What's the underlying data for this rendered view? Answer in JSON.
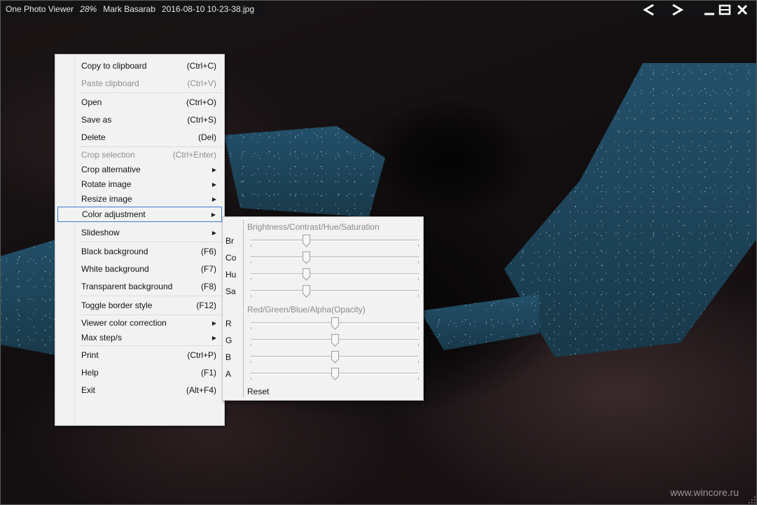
{
  "titlebar": {
    "app_name": "One Photo Viewer",
    "zoom": "28%",
    "author": "Mark Basarab",
    "filename": "2016-08-10 10-23-38.jpg"
  },
  "window_controls": {
    "prev_icon": "chevron-left-icon",
    "next_icon": "chevron-right-icon",
    "minimize_icon": "minimize-icon",
    "maximize_icon": "maximize-icon",
    "close_icon": "close-icon"
  },
  "menu": {
    "items": [
      {
        "label": "Copy to clipboard",
        "shortcut": "(Ctrl+C)"
      },
      {
        "label": "Paste clipboard",
        "shortcut": "(Ctrl+V)"
      },
      {
        "label": "Open",
        "shortcut": "(Ctrl+O)"
      },
      {
        "label": "Save as",
        "shortcut": "(Ctrl+S)"
      },
      {
        "label": "Delete",
        "shortcut": "(Del)"
      },
      {
        "label": "Crop selection",
        "shortcut": "(Ctrl+Enter)"
      },
      {
        "label": "Crop alternative"
      },
      {
        "label": "Rotate image"
      },
      {
        "label": "Resize image"
      },
      {
        "label": "Color adjustment"
      },
      {
        "label": "Slideshow"
      },
      {
        "label": "Black background",
        "shortcut": "(F6)"
      },
      {
        "label": "White background",
        "shortcut": "(F7)"
      },
      {
        "label": "Transparent background",
        "shortcut": "(F8)"
      },
      {
        "label": "Toggle border style",
        "shortcut": "(F12)"
      },
      {
        "label": "Viewer color correction"
      },
      {
        "label": "Max step/s"
      },
      {
        "label": "Print",
        "shortcut": "(Ctrl+P)"
      },
      {
        "label": "Help",
        "shortcut": "(F1)"
      },
      {
        "label": "Exit",
        "shortcut": "(Alt+F4)"
      }
    ]
  },
  "color_panel": {
    "group1_title": "Brightness/Contrast/Hue/Saturation",
    "group2_title": "Red/Green/Blue/Alpha(Opacity)",
    "sliders1": [
      {
        "label": "Br",
        "value": 0.33
      },
      {
        "label": "Co",
        "value": 0.33
      },
      {
        "label": "Hu",
        "value": 0.33
      },
      {
        "label": "Sa",
        "value": 0.33
      }
    ],
    "sliders2": [
      {
        "label": "R",
        "value": 0.5
      },
      {
        "label": "G",
        "value": 0.5
      },
      {
        "label": "B",
        "value": 0.5
      },
      {
        "label": "A",
        "value": 0.5
      }
    ],
    "reset_label": "Reset"
  },
  "watermark": "www.wincore.ru",
  "colors": {
    "highlight_border": "#3a7bd5",
    "menu_bg": "#f2f2f2",
    "disabled_text": "#8e8e8e"
  }
}
